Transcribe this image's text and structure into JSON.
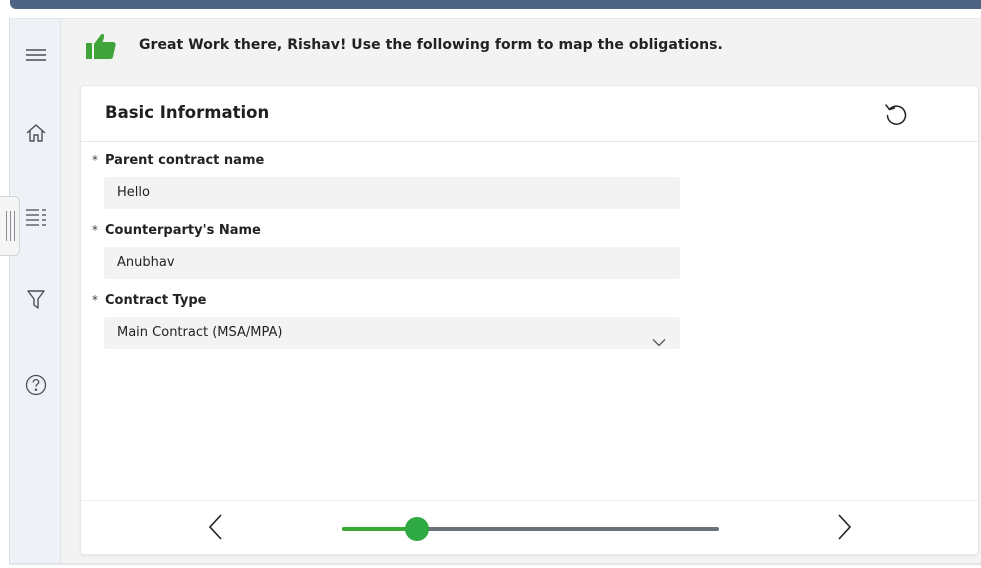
{
  "banner": {
    "message": "Great Work there, Rishav! Use the following form to map the obligations.",
    "icon": "thumbs-up-icon",
    "icon_color": "#3fa43a"
  },
  "sidebar": {
    "items": [
      {
        "icon": "hamburger-menu-icon"
      },
      {
        "icon": "home-icon"
      },
      {
        "icon": "list-icon",
        "active": true
      },
      {
        "icon": "filter-icon"
      },
      {
        "icon": "help-icon"
      }
    ]
  },
  "card": {
    "title": "Basic Information",
    "refresh_icon": "undo-icon"
  },
  "form": {
    "parent_contract": {
      "required_mark": "*",
      "label": "Parent contract name",
      "value": "Hello"
    },
    "counterparty": {
      "required_mark": "*",
      "label": "Counterparty's Name",
      "value": "Anubhav"
    },
    "contract_type": {
      "required_mark": "*",
      "label": "Contract Type",
      "value": "Main Contract (MSA/MPA)"
    }
  },
  "progress": {
    "fraction": 0.2,
    "fill_color": "#3aaa35",
    "track_color": "#69717a"
  },
  "colors": {
    "topbar": "#4e6482",
    "accent_green": "#2fa944"
  }
}
